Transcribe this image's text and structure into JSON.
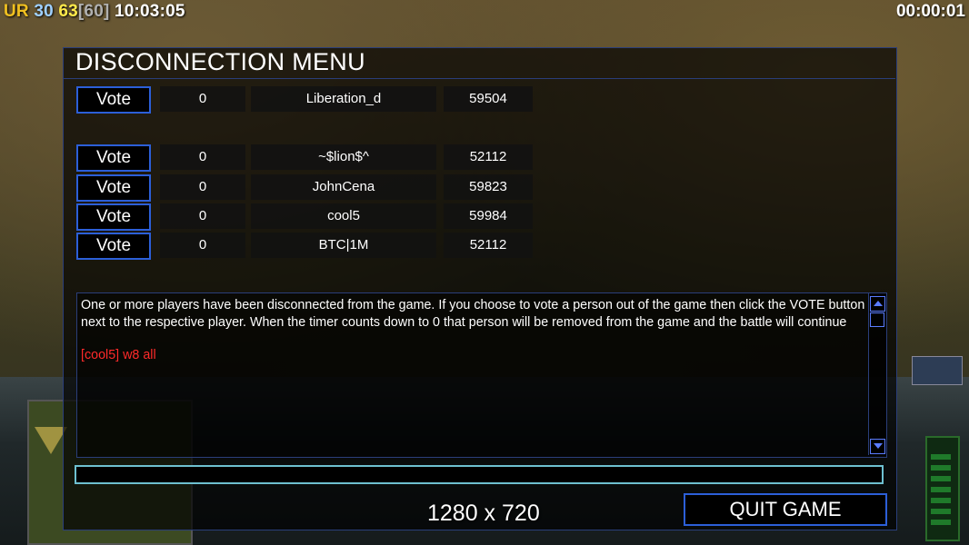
{
  "hud": {
    "label": "UR",
    "fps": "30",
    "value": "63",
    "value_max": "[60]",
    "clock": "10:03:05",
    "timer": "00:00:01",
    "colors": {
      "label": "#f0c020",
      "fps": "#9fd0ff",
      "value": "#ffea4a",
      "value_max": "#b0b0b0"
    }
  },
  "dialog": {
    "title": "DISCONNECTION MENU",
    "vote_label": "Vote",
    "players": [
      {
        "count": "0",
        "name": "Liberation_d",
        "ping": "59504"
      },
      {
        "count": "0",
        "name": "~$lion$^",
        "ping": "52112"
      },
      {
        "count": "0",
        "name": "JohnCena",
        "ping": "59823"
      },
      {
        "count": "0",
        "name": "cool5",
        "ping": "59984"
      },
      {
        "count": "0",
        "name": "BTC|1M",
        "ping": "52112"
      }
    ],
    "info_text": "One or more players have been disconnected from the game. If you choose to vote a person out of the game then click the VOTE button next to the respective player. When the timer counts down to 0 that person will be removed from the game and the battle will continue",
    "chat_message": "[cool5] w8 all",
    "chat_input_value": "",
    "quit_label": "QUIT GAME",
    "resolution": "1280 x 720"
  }
}
